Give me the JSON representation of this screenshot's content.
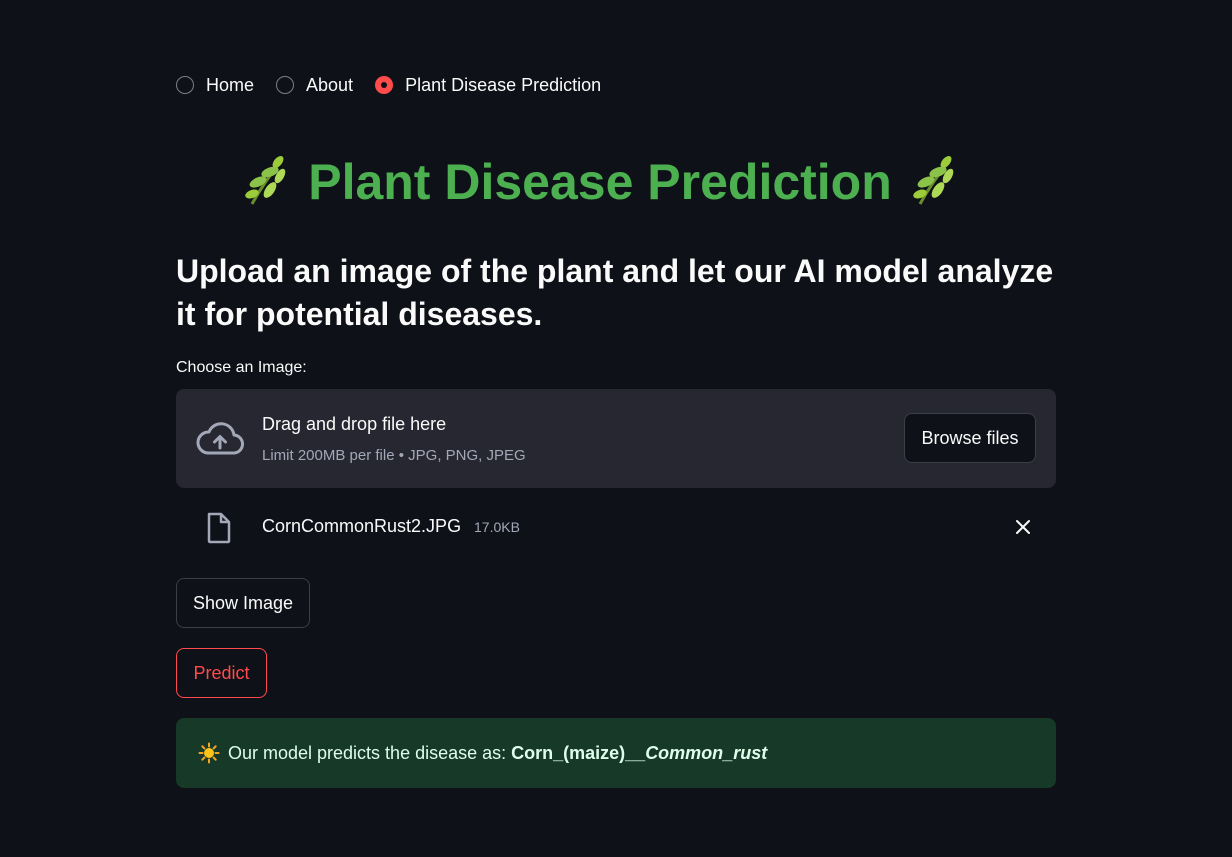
{
  "nav": {
    "options": [
      {
        "label": "Home",
        "selected": false
      },
      {
        "label": "About",
        "selected": false
      },
      {
        "label": "Plant Disease Prediction",
        "selected": true
      }
    ]
  },
  "header": {
    "title": "Plant Disease Prediction",
    "title_color": "#4caf50",
    "decoration_icon": "herb-icon"
  },
  "subtitle": "Upload an image of the plant and let our AI model analyze it for potential diseases.",
  "uploader": {
    "label": "Choose an Image:",
    "drop_title": "Drag and drop file here",
    "limit_text": "Limit 200MB per file • JPG, PNG, JPEG",
    "browse_label": "Browse files",
    "icon": "cloud-upload-icon"
  },
  "uploaded_file": {
    "name": "CornCommonRust2.JPG",
    "size": "17.0KB",
    "icon": "file-icon",
    "remove_icon": "close-icon"
  },
  "buttons": {
    "show_image": "Show Image",
    "predict": "Predict",
    "predict_color": "#ff4b4b"
  },
  "result": {
    "icon": "sun-icon",
    "prefix": "Our model predicts the disease as: ",
    "prediction_bold": "Corn_(maize)__",
    "prediction_italic": "Common_rust"
  },
  "colors": {
    "background": "#0e1117",
    "accent": "#ff4b4b",
    "success_bg": "#173928"
  }
}
